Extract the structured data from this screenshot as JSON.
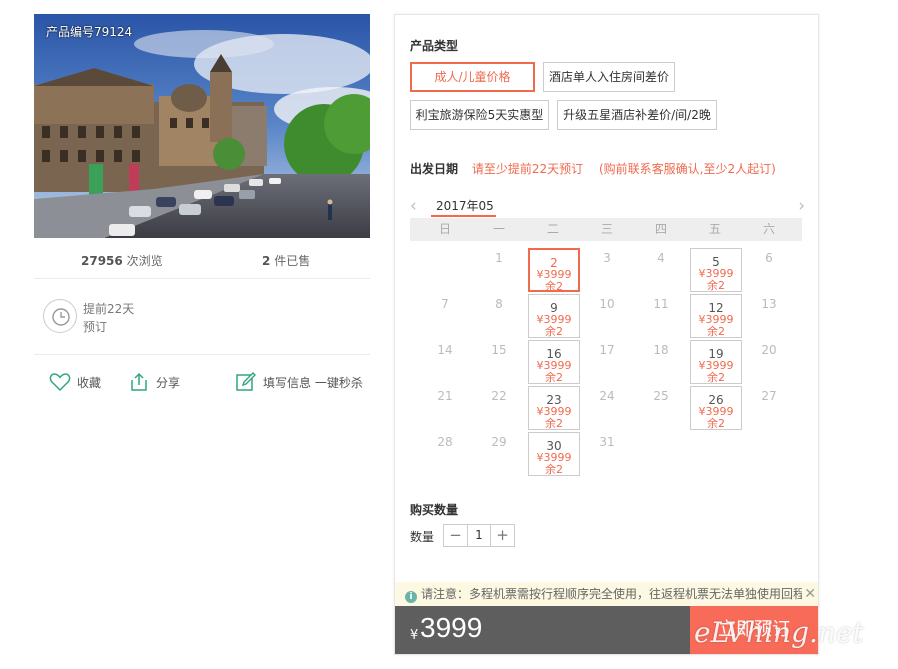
{
  "product": {
    "code_label": "产品编号79124",
    "views_count": "27956",
    "views_suffix": "次浏览",
    "sold_count": "2",
    "sold_suffix": "件已售",
    "advance_line1": "提前22天",
    "advance_line2": "预订"
  },
  "actions": {
    "favorite": "收藏",
    "share": "分享",
    "fill_info": "填写信息 一键秒杀"
  },
  "product_type": {
    "title": "产品类型",
    "options": [
      {
        "label": "成人/儿童价格",
        "selected": true
      },
      {
        "label": "酒店单人入住房间差价",
        "selected": false
      },
      {
        "label": "利宝旅游保险5天实惠型",
        "selected": false
      },
      {
        "label": "升级五星酒店补差价/间/2晚",
        "selected": false
      }
    ]
  },
  "departure": {
    "title": "出发日期",
    "warning1": "请至少提前22天预订",
    "warning2": "(购前联系客服确认,至少2人起订)"
  },
  "calendar": {
    "month": "2017年05",
    "prev_icon": "‹",
    "next_icon": "›",
    "weekdays": [
      "日",
      "一",
      "二",
      "三",
      "四",
      "五",
      "六"
    ],
    "days": [
      {
        "d": "1",
        "col": 1,
        "row": 0
      },
      {
        "d": "2",
        "col": 2,
        "row": 0,
        "price": "¥3999",
        "left": "余2",
        "selected": true
      },
      {
        "d": "3",
        "col": 3,
        "row": 0
      },
      {
        "d": "4",
        "col": 4,
        "row": 0
      },
      {
        "d": "5",
        "col": 5,
        "row": 0,
        "price": "¥3999",
        "left": "余2"
      },
      {
        "d": "6",
        "col": 6,
        "row": 0
      },
      {
        "d": "7",
        "col": 0,
        "row": 1
      },
      {
        "d": "8",
        "col": 1,
        "row": 1
      },
      {
        "d": "9",
        "col": 2,
        "row": 1,
        "price": "¥3999",
        "left": "余2"
      },
      {
        "d": "10",
        "col": 3,
        "row": 1
      },
      {
        "d": "11",
        "col": 4,
        "row": 1
      },
      {
        "d": "12",
        "col": 5,
        "row": 1,
        "price": "¥3999",
        "left": "余2"
      },
      {
        "d": "13",
        "col": 6,
        "row": 1
      },
      {
        "d": "14",
        "col": 0,
        "row": 2
      },
      {
        "d": "15",
        "col": 1,
        "row": 2
      },
      {
        "d": "16",
        "col": 2,
        "row": 2,
        "price": "¥3999",
        "left": "余2"
      },
      {
        "d": "17",
        "col": 3,
        "row": 2
      },
      {
        "d": "18",
        "col": 4,
        "row": 2
      },
      {
        "d": "19",
        "col": 5,
        "row": 2,
        "price": "¥3999",
        "left": "余2"
      },
      {
        "d": "20",
        "col": 6,
        "row": 2
      },
      {
        "d": "21",
        "col": 0,
        "row": 3
      },
      {
        "d": "22",
        "col": 1,
        "row": 3
      },
      {
        "d": "23",
        "col": 2,
        "row": 3,
        "price": "¥3999",
        "left": "余2"
      },
      {
        "d": "24",
        "col": 3,
        "row": 3
      },
      {
        "d": "25",
        "col": 4,
        "row": 3
      },
      {
        "d": "26",
        "col": 5,
        "row": 3,
        "price": "¥3999",
        "left": "余2"
      },
      {
        "d": "27",
        "col": 6,
        "row": 3
      },
      {
        "d": "28",
        "col": 0,
        "row": 4
      },
      {
        "d": "29",
        "col": 1,
        "row": 4
      },
      {
        "d": "30",
        "col": 2,
        "row": 4,
        "price": "¥3999",
        "left": "余2"
      },
      {
        "d": "31",
        "col": 3,
        "row": 4
      }
    ]
  },
  "quantity": {
    "title": "购买数量",
    "label": "数量",
    "minus": "−",
    "value": "1",
    "plus": "+"
  },
  "notice": {
    "icon": "i",
    "text": "请注意：多程机票需按行程顺序完全使用，往返程机票无法单独使用回程",
    "close": "✕"
  },
  "buy": {
    "currency": "¥",
    "total": "3999",
    "button": "立即预订"
  },
  "watermark": "eLVhing.net",
  "colors": {
    "accent": "#f06a4e",
    "button": "#f86b59",
    "bar": "#5e5e5e",
    "icon_green": "#2fa77f"
  }
}
